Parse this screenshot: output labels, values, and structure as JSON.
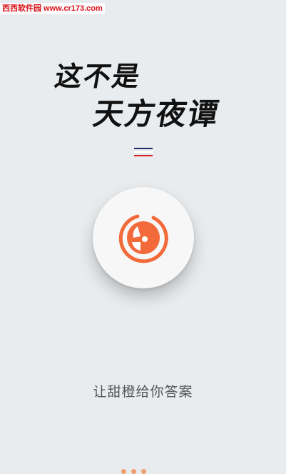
{
  "watermark": "西西软件园 www.cr173.com",
  "splash": {
    "slogan_line1": "这不是",
    "slogan_line2": "天方夜谭",
    "tagline": "让甜橙给你答案"
  },
  "colors": {
    "brand_orange": "#f26a3a",
    "background": "#e9ecee",
    "stripe_top": "#1e2a6b",
    "stripe_middle": "#ffffff",
    "stripe_bottom": "#d61c22"
  },
  "icons": {
    "logo": "orange-slice-logo-icon"
  },
  "page_indicator": {
    "count": 3
  }
}
